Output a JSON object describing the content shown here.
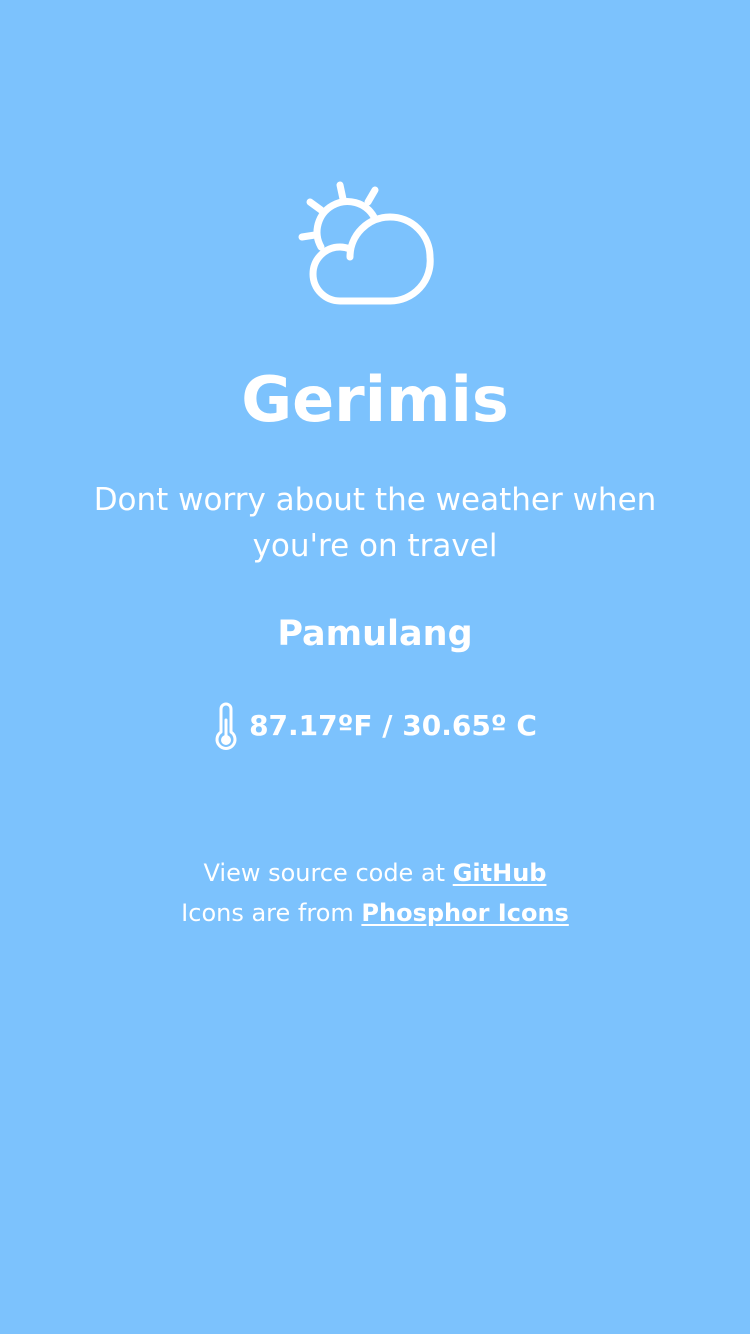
{
  "app": {
    "title": "Gerimis",
    "tagline": "Dont worry about the weather when you're on travel"
  },
  "weather": {
    "icon": "cloud-sun-icon",
    "location": "Pamulang",
    "temperature_icon": "thermometer-icon",
    "temperature": "87.17ºF / 30.65º C"
  },
  "credits": {
    "source_prefix": "View source code at ",
    "source_link": "GitHub",
    "icons_prefix": "Icons are from ",
    "icons_link": "Phosphor Icons"
  },
  "colors": {
    "background": "#7cc2fd",
    "foreground": "#ffffff"
  }
}
